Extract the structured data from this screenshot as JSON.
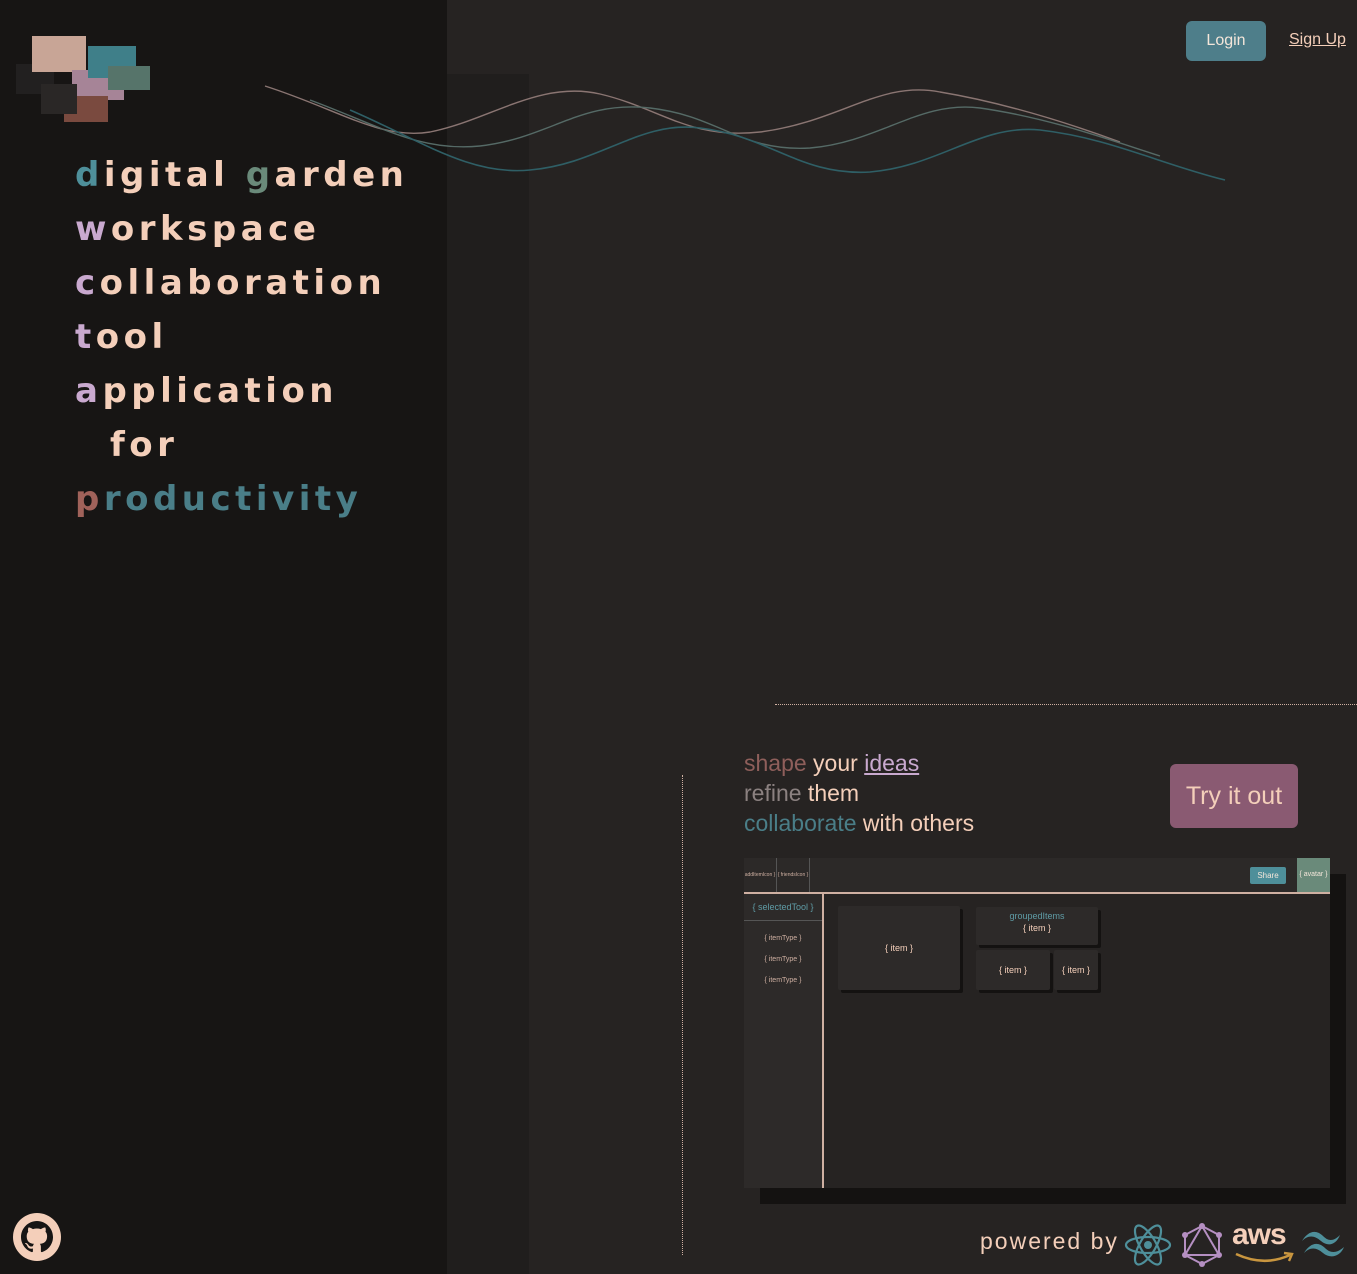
{
  "hero": {
    "lines": [
      {
        "first": "d",
        "rest": "igital ",
        "first2": "g",
        "rest2": "arden"
      },
      {
        "first": "w",
        "rest": "orkspace"
      },
      {
        "first": "c",
        "rest": "ollaboration"
      },
      {
        "first": "t",
        "rest": "ool"
      },
      {
        "first": "a",
        "rest": "pplication"
      },
      {
        "first": "",
        "rest": "for"
      },
      {
        "first": "p",
        "rest": "roductivity"
      }
    ]
  },
  "header": {
    "login_label": "Login",
    "signup_label": "Sign Up"
  },
  "tagline": {
    "line1_a": "shape",
    "line1_b": " your ",
    "line1_c": "ideas",
    "line2_a": "refine",
    "line2_b": " them",
    "line3_a": "collaborate",
    "line3_b": " with others"
  },
  "cta": {
    "try_label": "Try it out"
  },
  "mockup": {
    "toolbar": [
      "addItemIcon }",
      "{ friendsIcon }"
    ],
    "share_label": "Share",
    "avatar_label": "{ avatar }",
    "selected_tool": "{ selectedTool }",
    "item_types": [
      "{ itemType }",
      "{ itemType }",
      "{ itemType }"
    ],
    "item_label": "{ item }",
    "grouped_label": "groupedItems",
    "grouped_item_label": "{ item }",
    "small_items": [
      "{ item }",
      "{ item }"
    ]
  },
  "footer": {
    "powered_label": "powered by",
    "tech_icons": [
      "react-icon",
      "graphql-icon",
      "aws-icon",
      "tailwind-icon"
    ],
    "aws_text": "aws",
    "github_icon": "github-icon"
  },
  "colors": {
    "background": "#262322",
    "panel": "#171514",
    "cream": "#f4cfba",
    "teal": "#4e7e8a",
    "mauve": "#8a5a72",
    "lilac": "#c9a9cf",
    "rust": "#8f5f5b",
    "sage": "#6a8a7a"
  }
}
